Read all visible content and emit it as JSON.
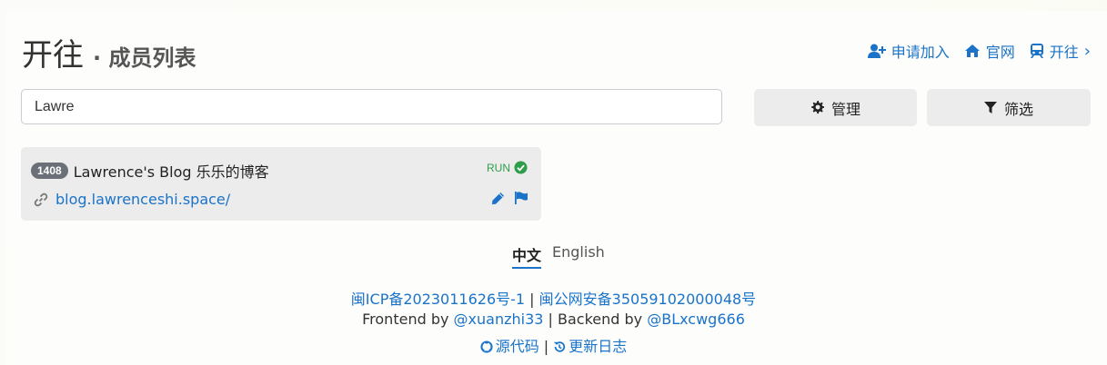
{
  "header": {
    "site_title": "开往",
    "subtitle": "· 成员列表"
  },
  "top_links": {
    "apply": "申请加入",
    "website": "官网",
    "travel": "开往",
    "travel_chevron": "›"
  },
  "search": {
    "value": "Lawre"
  },
  "buttons": {
    "manage": "管理",
    "filter": "筛选"
  },
  "member": {
    "id": "1408",
    "name": "Lawrence's Blog 乐乐的博客",
    "status": "RUN",
    "url": "blog.lawrenceshi.space/"
  },
  "language": {
    "active": "中文",
    "other": "English"
  },
  "footer": {
    "icp": "闽ICP备2023011626号-1",
    "separator1": " | ",
    "police": "闽公网安备35059102000048号",
    "frontend_prefix": "Frontend by ",
    "frontend_author": "@xuanzhi33",
    "backend_prefix": " | Backend by ",
    "backend_author": "@BLxcwg666",
    "source": "源代码",
    "separator2": " | ",
    "changelog": "更新日志"
  },
  "colors": {
    "accent": "#1a73c8",
    "success": "#2e9e4a",
    "badge": "#6b7078",
    "button_bg": "#ececec"
  }
}
